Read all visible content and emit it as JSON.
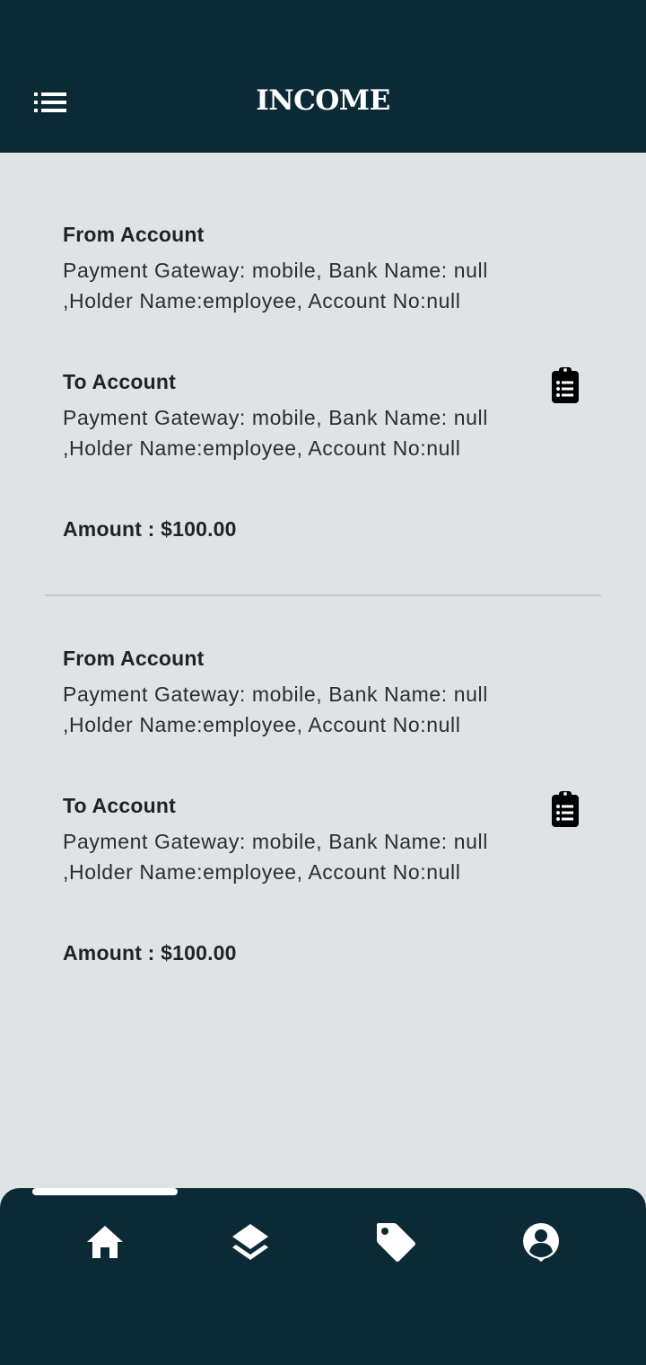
{
  "app_bar": {
    "title": "INCOME",
    "menu_icon": "list-menu-icon"
  },
  "transactions": [
    {
      "from_label": "From Account",
      "from_text": "Payment Gateway: mobile, Bank Name: null ,Holder Name:employee, Account No:null",
      "to_label": "To Account",
      "to_text": "Payment Gateway: mobile, Bank Name: null ,Holder Name:employee, Account No:null",
      "amount": "Amount : $100.00",
      "action_icon": "clipboard-list-icon"
    },
    {
      "from_label": "From Account",
      "from_text": "Payment Gateway: mobile, Bank Name: null ,Holder Name:employee, Account No:null",
      "to_label": "To Account",
      "to_text": "Payment Gateway: mobile, Bank Name: null ,Holder Name:employee, Account No:null",
      "amount": "Amount : $100.00",
      "action_icon": "clipboard-list-icon"
    }
  ],
  "bottom_nav": {
    "selected_index": 0,
    "items": [
      {
        "icon": "home-icon"
      },
      {
        "icon": "layers-icon"
      },
      {
        "icon": "tag-icon"
      },
      {
        "icon": "account-circle-icon"
      }
    ]
  },
  "colors": {
    "bar_background": "#0b2a36",
    "page_background": "#dfe3e6",
    "text": "#1f2326",
    "icon_on_bar": "#ffffff"
  }
}
